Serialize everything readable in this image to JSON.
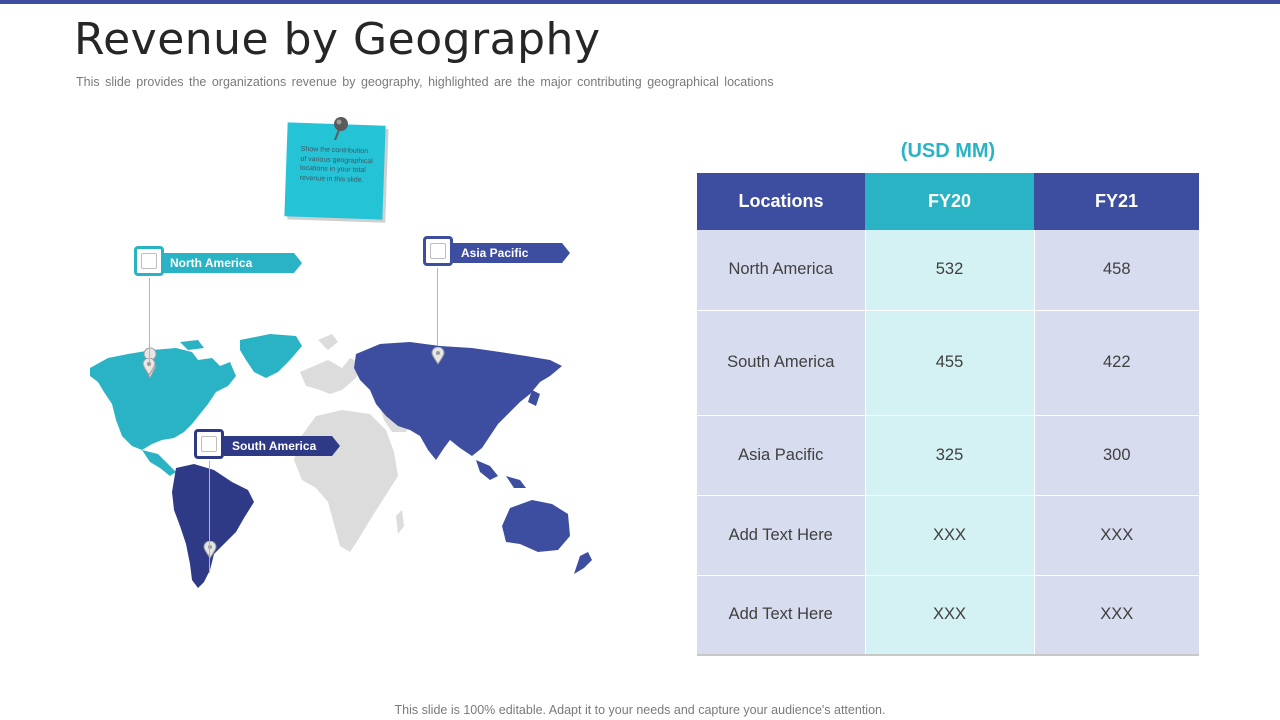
{
  "slide": {
    "title": "Revenue by Geography",
    "subtitle": "This slide provides the organizations revenue  by geography, highlighted are the major contributing geographical locations",
    "footer": "This slide is 100% editable. Adapt it to your needs and capture your audience's attention."
  },
  "sticky_note": {
    "text": "Show the contribution of various geographical locations in your total revenue in this slide."
  },
  "map": {
    "callouts": {
      "north_america": "North America",
      "asia_pacific": "Asia Pacific",
      "south_america": "South America"
    },
    "colors": {
      "north_america": "#2ab3c5",
      "south_america": "#2e3a86",
      "asia_pacific": "#3d4ea0",
      "other": "#dcdcdc"
    }
  },
  "table": {
    "unit_label": "(USD MM)",
    "headers": [
      "Locations",
      "FY20",
      "FY21"
    ],
    "rows": [
      [
        "North America",
        "532",
        "458"
      ],
      [
        "South America",
        "455",
        "422"
      ],
      [
        "Asia Pacific",
        "325",
        "300"
      ],
      [
        "Add Text Here",
        "XXX",
        "XXX"
      ],
      [
        "Add Text Here",
        "XXX",
        "XXX"
      ]
    ]
  },
  "colors": {
    "accent_blue": "#3d4ea0",
    "accent_teal": "#2ab3c5"
  }
}
